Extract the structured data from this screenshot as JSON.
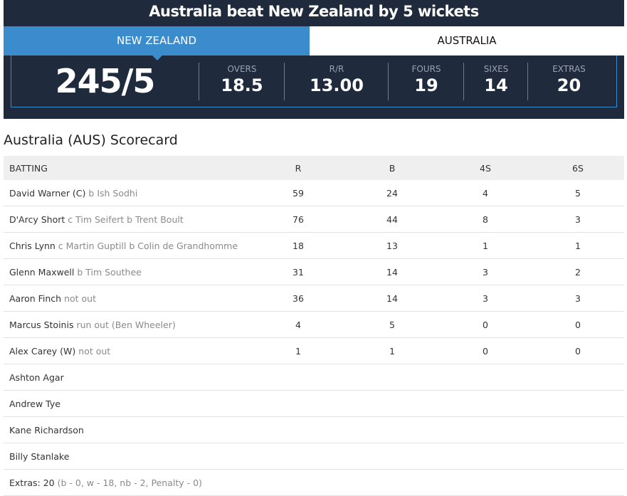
{
  "result_title": "Australia beat New Zealand by 5 wickets",
  "tabs": [
    {
      "label": "NEW ZEALAND",
      "active": true
    },
    {
      "label": "AUSTRALIA",
      "active": false
    }
  ],
  "summary": {
    "total": "245/5",
    "stats": [
      {
        "label": "OVERS",
        "value": "18.5"
      },
      {
        "label": "R/R",
        "value": "13.00"
      },
      {
        "label": "FOURS",
        "value": "19"
      },
      {
        "label": "SIXES",
        "value": "14"
      },
      {
        "label": "EXTRAS",
        "value": "20"
      }
    ]
  },
  "scorecard": {
    "title": "Australia (AUS) Scorecard",
    "headers": [
      "BATTING",
      "R",
      "B",
      "4S",
      "6S"
    ],
    "rows": [
      {
        "name": "David Warner (C)",
        "dismissal": "b Ish Sodhi",
        "r": "59",
        "b": "24",
        "fours": "4",
        "sixes": "5"
      },
      {
        "name": "D'Arcy Short",
        "dismissal": "c Tim Seifert b Trent Boult",
        "r": "76",
        "b": "44",
        "fours": "8",
        "sixes": "3"
      },
      {
        "name": "Chris Lynn",
        "dismissal": "c Martin Guptill b Colin de Grandhomme",
        "r": "18",
        "b": "13",
        "fours": "1",
        "sixes": "1"
      },
      {
        "name": "Glenn Maxwell",
        "dismissal": "b Tim Southee",
        "r": "31",
        "b": "14",
        "fours": "3",
        "sixes": "2"
      },
      {
        "name": "Aaron Finch",
        "dismissal": "not out",
        "r": "36",
        "b": "14",
        "fours": "3",
        "sixes": "3"
      },
      {
        "name": "Marcus Stoinis",
        "dismissal": "run out (Ben Wheeler)",
        "r": "4",
        "b": "5",
        "fours": "0",
        "sixes": "0"
      },
      {
        "name": "Alex Carey (W)",
        "dismissal": "not out",
        "r": "1",
        "b": "1",
        "fours": "0",
        "sixes": "0"
      },
      {
        "name": "Ashton Agar",
        "dismissal": "",
        "r": "",
        "b": "",
        "fours": "",
        "sixes": ""
      },
      {
        "name": "Andrew Tye",
        "dismissal": "",
        "r": "",
        "b": "",
        "fours": "",
        "sixes": ""
      },
      {
        "name": "Kane Richardson",
        "dismissal": "",
        "r": "",
        "b": "",
        "fours": "",
        "sixes": ""
      },
      {
        "name": "Billy Stanlake",
        "dismissal": "",
        "r": "",
        "b": "",
        "fours": "",
        "sixes": ""
      }
    ],
    "extras": {
      "label": "Extras: 20",
      "detail": "(b - 0, w - 18, nb - 2, Penalty - 0)"
    }
  },
  "colors": {
    "banner_bg": "#1f2a3c",
    "accent": "#3a8ccc",
    "header_row_bg": "#efefef"
  }
}
